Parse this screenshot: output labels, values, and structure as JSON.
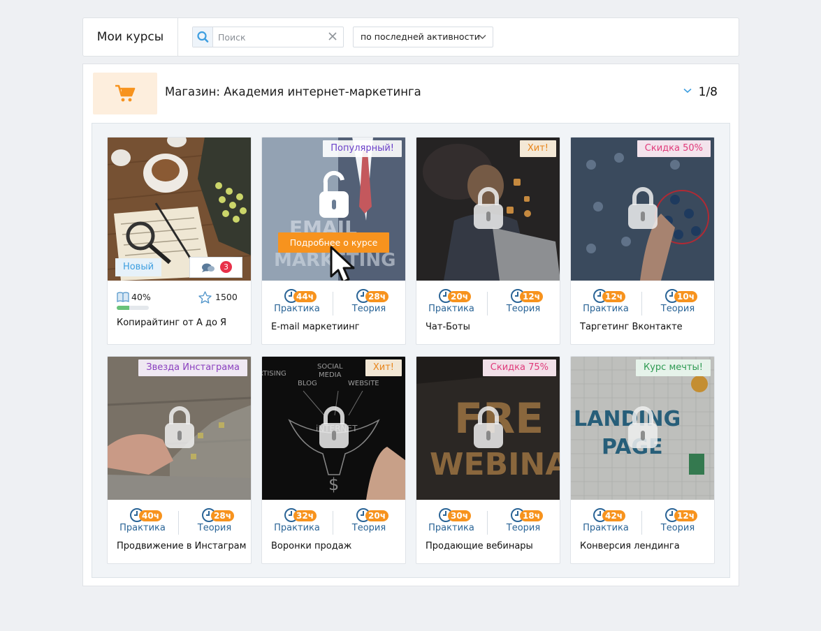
{
  "header": {
    "title": "Мои курсы",
    "search_placeholder": "Поиск",
    "sort_label": "по последней активности"
  },
  "shop": {
    "title": "Магазин: Академия интернет-маркетинга",
    "pager": "1/8"
  },
  "colors": {
    "accent": "#f7931e",
    "blue": "#2a6496"
  },
  "cards": [
    {
      "title": "Копирайтинг от А до Я",
      "badge": "Новый",
      "progress_label": "40%",
      "progress": 0.4,
      "points": "1500",
      "comments": "3"
    },
    {
      "title": "E-mail маркетиинг",
      "badge": "Популярный!",
      "practice": "44ч",
      "theory": "28ч",
      "button": "Подробнее о курсе"
    },
    {
      "title": "Чат-Боты",
      "badge": "Хит!",
      "practice": "20ч",
      "theory": "12ч"
    },
    {
      "title": "Таргетинг Вконтакте",
      "badge": "Скидка 50%",
      "practice": "12ч",
      "theory": "10ч"
    },
    {
      "title": "Продвижение в Инстаграм",
      "badge": "Звезда Инстаграма",
      "practice": "40ч",
      "theory": "28ч"
    },
    {
      "title": "Воронки продаж",
      "badge": "Хит!",
      "practice": "32ч",
      "theory": "20ч"
    },
    {
      "title": "Продающие вебинары",
      "badge": "Скидка 75%",
      "practice": "30ч",
      "theory": "18ч"
    },
    {
      "title": "Конверсия лендинга",
      "badge": "Курс мечты!",
      "practice": "42ч",
      "theory": "12ч"
    }
  ],
  "labels": {
    "practice": "Практика",
    "theory": "Теория"
  }
}
